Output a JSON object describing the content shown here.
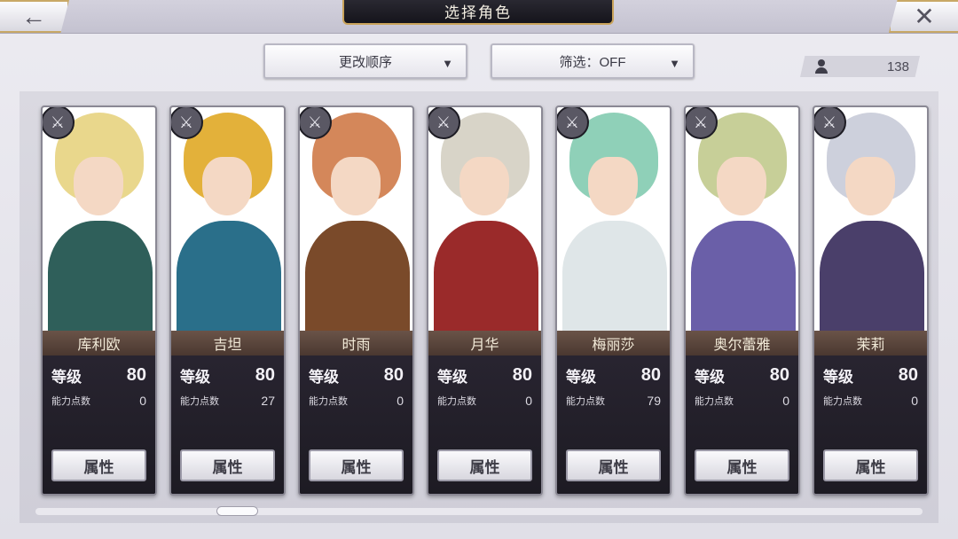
{
  "header": {
    "title": "选择角色",
    "back_icon": "←",
    "close_icon": "✕"
  },
  "toolbar": {
    "sort_label": "更改顺序",
    "filter_label": "筛选：OFF",
    "caret": "▼",
    "character_count": "138"
  },
  "card_labels": {
    "level": "等级",
    "ability_points": "能力点数",
    "attr_button": "属性"
  },
  "characters": [
    {
      "name": "库利欧",
      "level": "80",
      "ability_points": "0",
      "hair": "#e9d78c",
      "outfit": "#2f5f5a"
    },
    {
      "name": "吉坦",
      "level": "80",
      "ability_points": "27",
      "hair": "#e3b13a",
      "outfit": "#2a6f8a"
    },
    {
      "name": "时雨",
      "level": "80",
      "ability_points": "0",
      "hair": "#d4875a",
      "outfit": "#7a4a2a"
    },
    {
      "name": "月华",
      "level": "80",
      "ability_points": "0",
      "hair": "#d8d4c8",
      "outfit": "#9a2a2a"
    },
    {
      "name": "梅丽莎",
      "level": "80",
      "ability_points": "79",
      "hair": "#8fd0b8",
      "outfit": "#dfe6e8"
    },
    {
      "name": "奥尔蕾雅",
      "level": "80",
      "ability_points": "0",
      "hair": "#c7cf98",
      "outfit": "#6a5fa8"
    },
    {
      "name": "茉莉",
      "level": "80",
      "ability_points": "0",
      "hair": "#cdd0dc",
      "outfit": "#4a3f6a"
    }
  ]
}
